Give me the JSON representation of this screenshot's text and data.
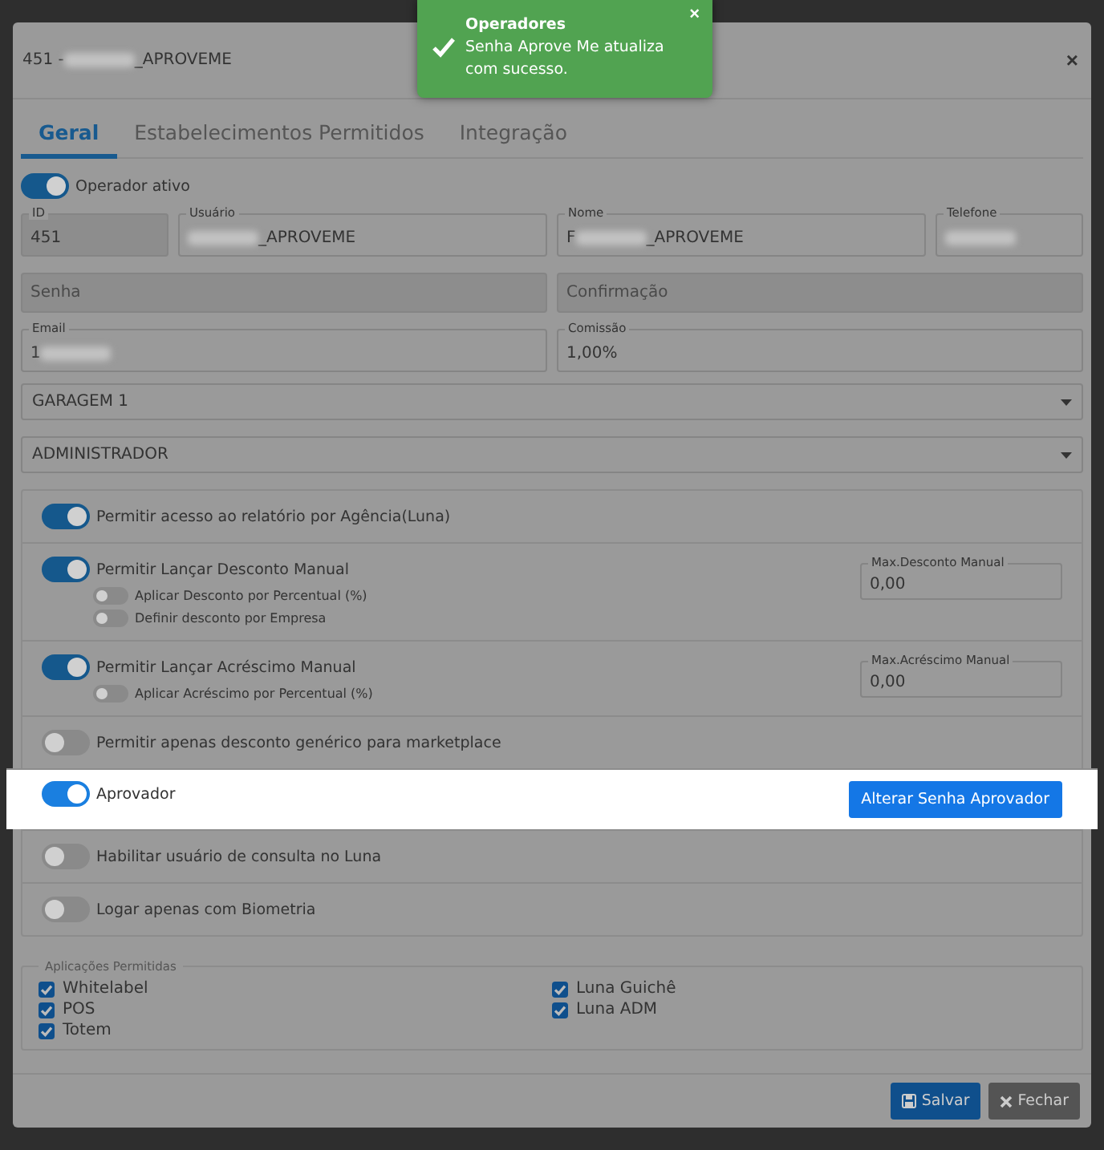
{
  "toast": {
    "title": "Operadores",
    "message": "Senha Aprove Me atualiza com sucesso.",
    "close": "×"
  },
  "modal": {
    "title": [
      {
        "kind": "text",
        "text": "451 - "
      },
      {
        "kind": "blur"
      },
      {
        "kind": "text",
        "text": "_APROVEME"
      }
    ],
    "close": "×"
  },
  "tabs": [
    {
      "label": "Geral",
      "selected": true
    },
    {
      "label": "Estabelecimentos Permitidos",
      "selected": false
    },
    {
      "label": "Integração",
      "selected": false
    }
  ],
  "active_toggle": {
    "label": "Operador ativo",
    "on": true
  },
  "field_rows": [
    [
      {
        "label": "ID",
        "parts": [
          {
            "kind": "text",
            "text": "451"
          }
        ],
        "disabled": true
      },
      {
        "label": "Usuário",
        "parts": [
          {
            "kind": "blur"
          },
          {
            "kind": "text",
            "text": "_APROVEME"
          }
        ],
        "disabled": false
      },
      {
        "label": "Nome",
        "parts": [
          {
            "kind": "text",
            "text": "F"
          },
          {
            "kind": "blur"
          },
          {
            "kind": "text",
            "text": "_APROVEME"
          }
        ],
        "disabled": false
      },
      {
        "label": "Telefone",
        "parts": [
          {
            "kind": "blur"
          }
        ],
        "disabled": false
      }
    ],
    [
      {
        "placeholder": "Senha",
        "disabled": true
      },
      {
        "placeholder": "Confirmação",
        "disabled": true
      }
    ],
    [
      {
        "label": "Email",
        "parts": [
          {
            "kind": "text",
            "text": "1"
          },
          {
            "kind": "blur"
          }
        ],
        "disabled": false
      },
      {
        "label": "Comissão",
        "parts": [
          {
            "kind": "text",
            "text": "1,00%"
          }
        ],
        "disabled": false
      }
    ]
  ],
  "selects": [
    "GARAGEM 1",
    "ADMINISTRADOR"
  ],
  "permissions": [
    {
      "kind": "toggle",
      "label": "Permitir acesso ao relatório por Agência(Luna)",
      "on": true,
      "highlighted": false
    },
    {
      "kind": "toggle",
      "label": "Permitir Lançar Desconto Manual",
      "on": true,
      "highlighted": false,
      "field": {
        "label": "Max.Desconto Manual",
        "value": "0,00"
      },
      "children": [
        {
          "label": "Aplicar Desconto por Percentual (%)",
          "on": false
        },
        {
          "label": "Definir desconto por Empresa",
          "on": false
        }
      ]
    },
    {
      "kind": "toggle",
      "label": "Permitir Lançar Acréscimo Manual",
      "on": true,
      "highlighted": false,
      "field": {
        "label": "Max.Acréscimo Manual",
        "value": "0,00"
      },
      "children": [
        {
          "label": "Aplicar Acréscimo por Percentual (%)",
          "on": false
        }
      ]
    },
    {
      "kind": "toggle",
      "label": "Permitir apenas desconto genérico para marketplace",
      "on": false,
      "highlighted": false
    },
    {
      "kind": "toggle",
      "label": "Aprovador",
      "on": true,
      "highlighted": true,
      "button": "Alterar Senha Aprovador"
    },
    {
      "kind": "toggle",
      "label": "Habilitar usuário de consulta no Luna",
      "on": false,
      "highlighted": false
    },
    {
      "kind": "toggle",
      "label": "Logar apenas com Biometria",
      "on": false,
      "highlighted": false
    }
  ],
  "applications": {
    "legend": "Aplicações Permitidas",
    "columns": [
      [
        {
          "label": "Whitelabel",
          "checked": true
        },
        {
          "label": "POS",
          "checked": true
        },
        {
          "label": "Totem",
          "checked": true
        }
      ],
      [
        {
          "label": "Luna Guichê",
          "checked": true
        },
        {
          "label": "Luna ADM",
          "checked": true
        }
      ]
    ]
  },
  "footer": {
    "save": "Salvar",
    "close": "Fechar"
  }
}
